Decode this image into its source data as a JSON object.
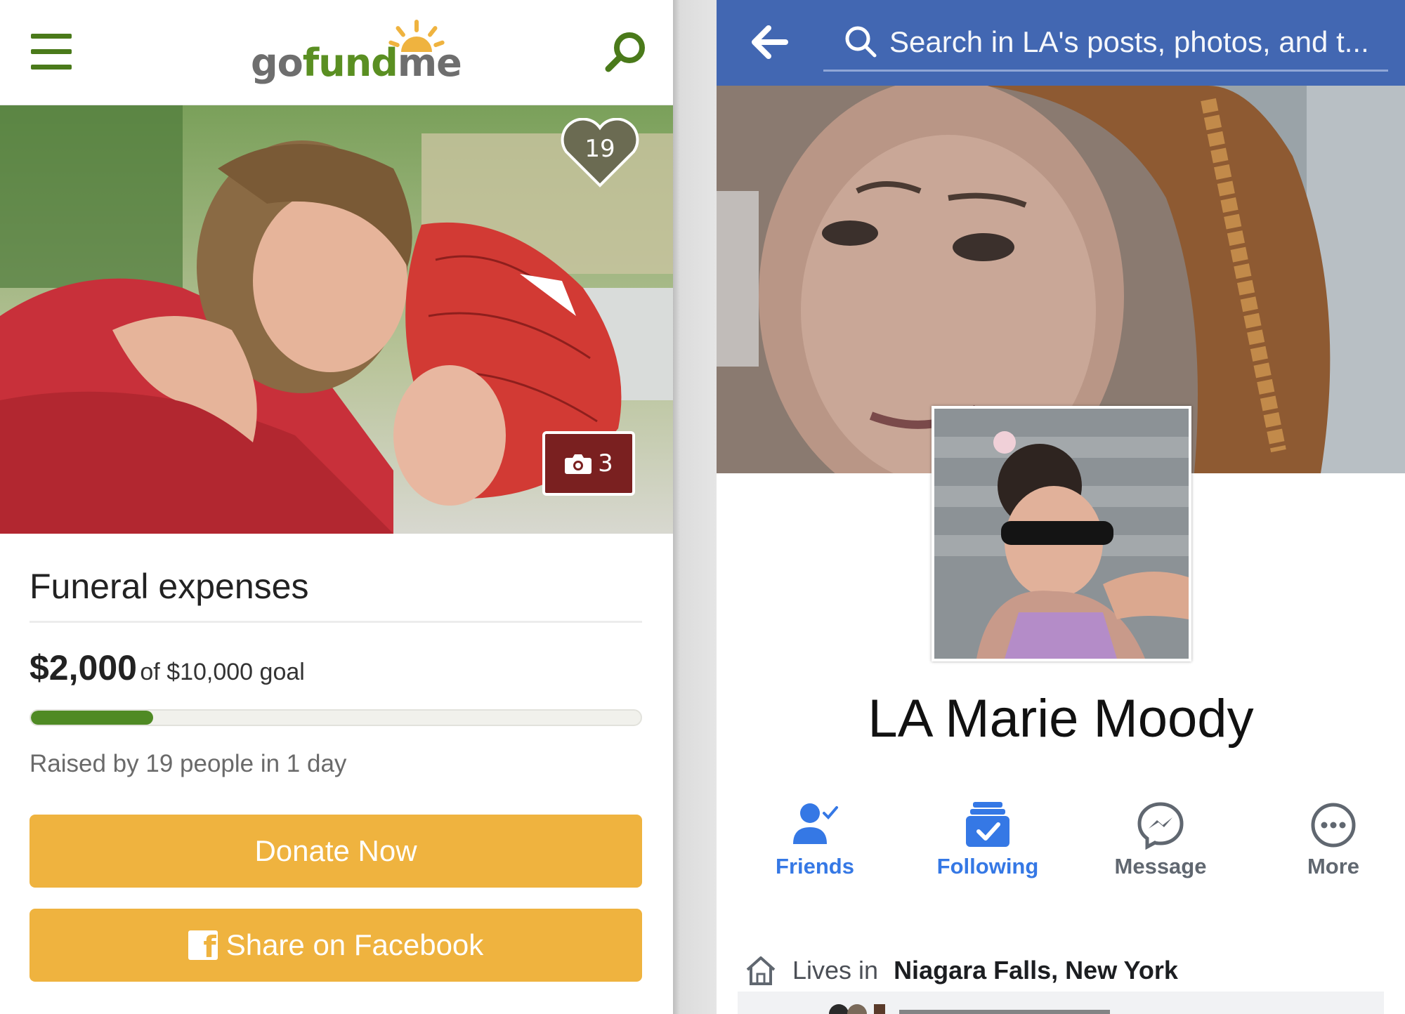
{
  "gofundme": {
    "header": {
      "menu_icon": "hamburger-icon",
      "logo_part1": "go",
      "logo_part2": "fund",
      "logo_part3": "me",
      "search_icon": "search-icon"
    },
    "hero": {
      "heart_count": "19",
      "photo_count": "3",
      "photo_icon": "camera-icon"
    },
    "campaign": {
      "title": "Funeral expenses",
      "raised_amount": "$2,000",
      "goal_text": "of $10,000 goal",
      "progress_fraction": 0.2,
      "raised_by": "Raised by 19 people in 1 day",
      "donate_label": "Donate Now",
      "share_label": "Share on Facebook"
    },
    "colors": {
      "brand_green": "#5a8f22",
      "button_orange": "#efb33f",
      "photo_badge": "#7a2020"
    }
  },
  "facebook": {
    "header": {
      "back_icon": "back-arrow-icon",
      "search_placeholder": "Search in LA's posts, photos, and t..."
    },
    "profile": {
      "name": "LA Marie Moody"
    },
    "actions": [
      {
        "label": "Friends",
        "icon": "friends-check-icon",
        "active": true
      },
      {
        "label": "Following",
        "icon": "following-check-icon",
        "active": true
      },
      {
        "label": "Message",
        "icon": "messenger-icon",
        "active": false
      },
      {
        "label": "More",
        "icon": "more-dots-icon",
        "active": false
      }
    ],
    "about": {
      "lives_prefix": "Lives in",
      "lives_place": "Niagara Falls, New York",
      "icon": "home-icon"
    },
    "colors": {
      "header_blue": "#4267b2",
      "action_blue": "#3578e5"
    }
  }
}
